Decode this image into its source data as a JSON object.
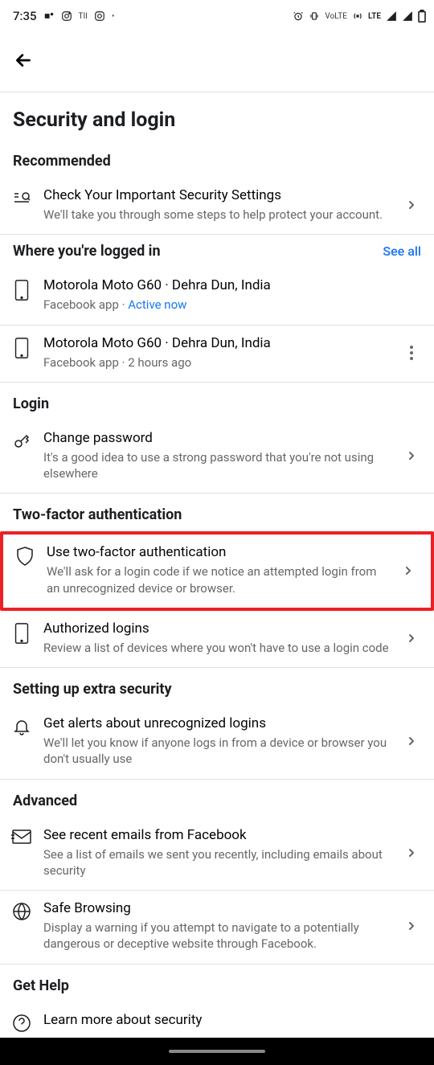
{
  "status": {
    "time": "7:35",
    "lte": "LTE",
    "volte": "VoLTE"
  },
  "title": "Security and login",
  "sections": {
    "recommended": {
      "heading": "Recommended",
      "check": {
        "title": "Check Your Important Security Settings",
        "subtitle": "We'll take you through some steps to help protect your account."
      }
    },
    "whereLoggedIn": {
      "heading": "Where you're logged in",
      "seeAll": "See all",
      "devices": [
        {
          "title": "Motorola Moto G60 · Dehra Dun, India",
          "app": "Facebook app",
          "status": "Active now",
          "active": true
        },
        {
          "title": "Motorola Moto G60 · Dehra Dun, India",
          "app": "Facebook app",
          "status": "2 hours ago",
          "active": false
        }
      ]
    },
    "login": {
      "heading": "Login",
      "changePassword": {
        "title": "Change password",
        "subtitle": "It's a good idea to use a strong password that you're not using elsewhere"
      }
    },
    "twoFactor": {
      "heading": "Two-factor authentication",
      "use2fa": {
        "title": "Use two-factor authentication",
        "subtitle": "We'll ask for a login code if we notice an attempted login from an unrecognized device or browser."
      },
      "authLogins": {
        "title": "Authorized logins",
        "subtitle": "Review a list of devices where you won't have to use a login code"
      }
    },
    "extraSecurity": {
      "heading": "Setting up extra security",
      "alerts": {
        "title": "Get alerts about unrecognized logins",
        "subtitle": "We'll let you know if anyone logs in from a device or browser you don't usually use"
      }
    },
    "advanced": {
      "heading": "Advanced",
      "emails": {
        "title": "See recent emails from Facebook",
        "subtitle": "See a list of emails we sent you recently, including emails about security"
      },
      "safeBrowsing": {
        "title": "Safe Browsing",
        "subtitle": "Display a warning if you attempt to navigate to a potentially dangerous or deceptive website through Facebook."
      }
    },
    "getHelp": {
      "heading": "Get Help",
      "learnMore": {
        "title": "Learn more about security"
      }
    }
  }
}
